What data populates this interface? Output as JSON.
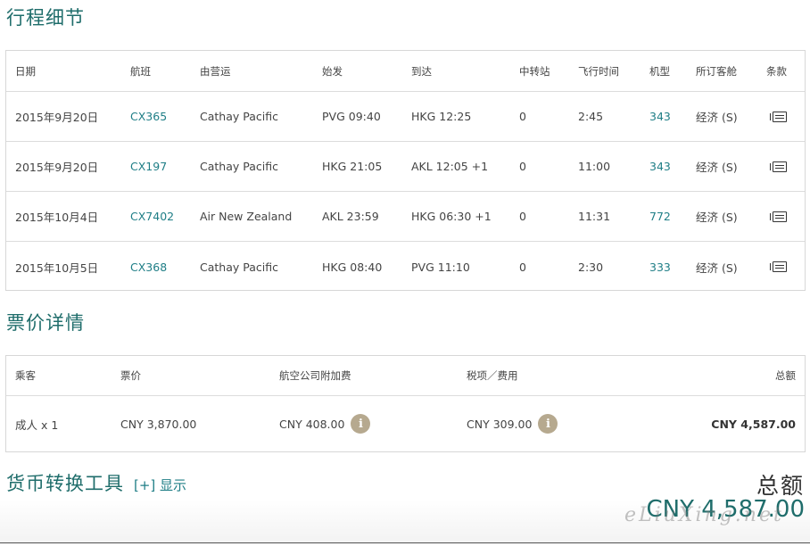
{
  "itinerary": {
    "title": "行程细节",
    "headers": {
      "date": "日期",
      "flight": "航班",
      "operator": "由营运",
      "departure": "始发",
      "arrival": "到达",
      "stops": "中转站",
      "duration": "飞行时间",
      "aircraft": "机型",
      "cabin": "所订客舱",
      "terms": "条款"
    },
    "rows": [
      {
        "date": "2015年9月20日",
        "flight": "CX365",
        "operator": "Cathay Pacific",
        "departure": "PVG 09:40",
        "arrival": "HKG 12:25",
        "stops": "0",
        "duration": "2:45",
        "aircraft": "343",
        "cabin": "经济 (S)",
        "terms_icon": "document-icon"
      },
      {
        "date": "2015年9月20日",
        "flight": "CX197",
        "operator": "Cathay Pacific",
        "departure": "HKG 21:05",
        "arrival": "AKL 12:05 +1",
        "stops": "0",
        "duration": "11:00",
        "aircraft": "343",
        "cabin": "经济 (S)",
        "terms_icon": "document-icon"
      },
      {
        "date": "2015年10月4日",
        "flight": "CX7402",
        "operator": "Air New Zealand",
        "departure": "AKL 23:59",
        "arrival": "HKG 06:30 +1",
        "stops": "0",
        "duration": "11:31",
        "aircraft": "772",
        "cabin": "经济 (S)",
        "terms_icon": "document-icon"
      },
      {
        "date": "2015年10月5日",
        "flight": "CX368",
        "operator": "Cathay Pacific",
        "departure": "HKG 08:40",
        "arrival": "PVG 11:10",
        "stops": "0",
        "duration": "2:30",
        "aircraft": "333",
        "cabin": "经济 (S)",
        "terms_icon": "document-icon"
      }
    ]
  },
  "fare": {
    "title": "票价详情",
    "headers": {
      "passenger": "乘客",
      "fare": "票价",
      "surcharge": "航空公司附加费",
      "taxes": "税项／费用",
      "total": "总额"
    },
    "row": {
      "passenger": "成人 x 1",
      "fare": "CNY 3,870.00",
      "surcharge": "CNY 408.00",
      "taxes": "CNY 309.00",
      "total": "CNY 4,587.00",
      "info_icon_glyph": "i"
    }
  },
  "converter": {
    "title": "货币转换工具",
    "toggle": "[+] 显示",
    "total_label": "总额",
    "total_value": "CNY 4,587.00"
  },
  "watermark": "eLiuXing.net",
  "colors": {
    "accent": "#1f6d6b",
    "link": "#1f7e86",
    "info_icon": "#b6a98f",
    "border": "#d7d7d7"
  }
}
